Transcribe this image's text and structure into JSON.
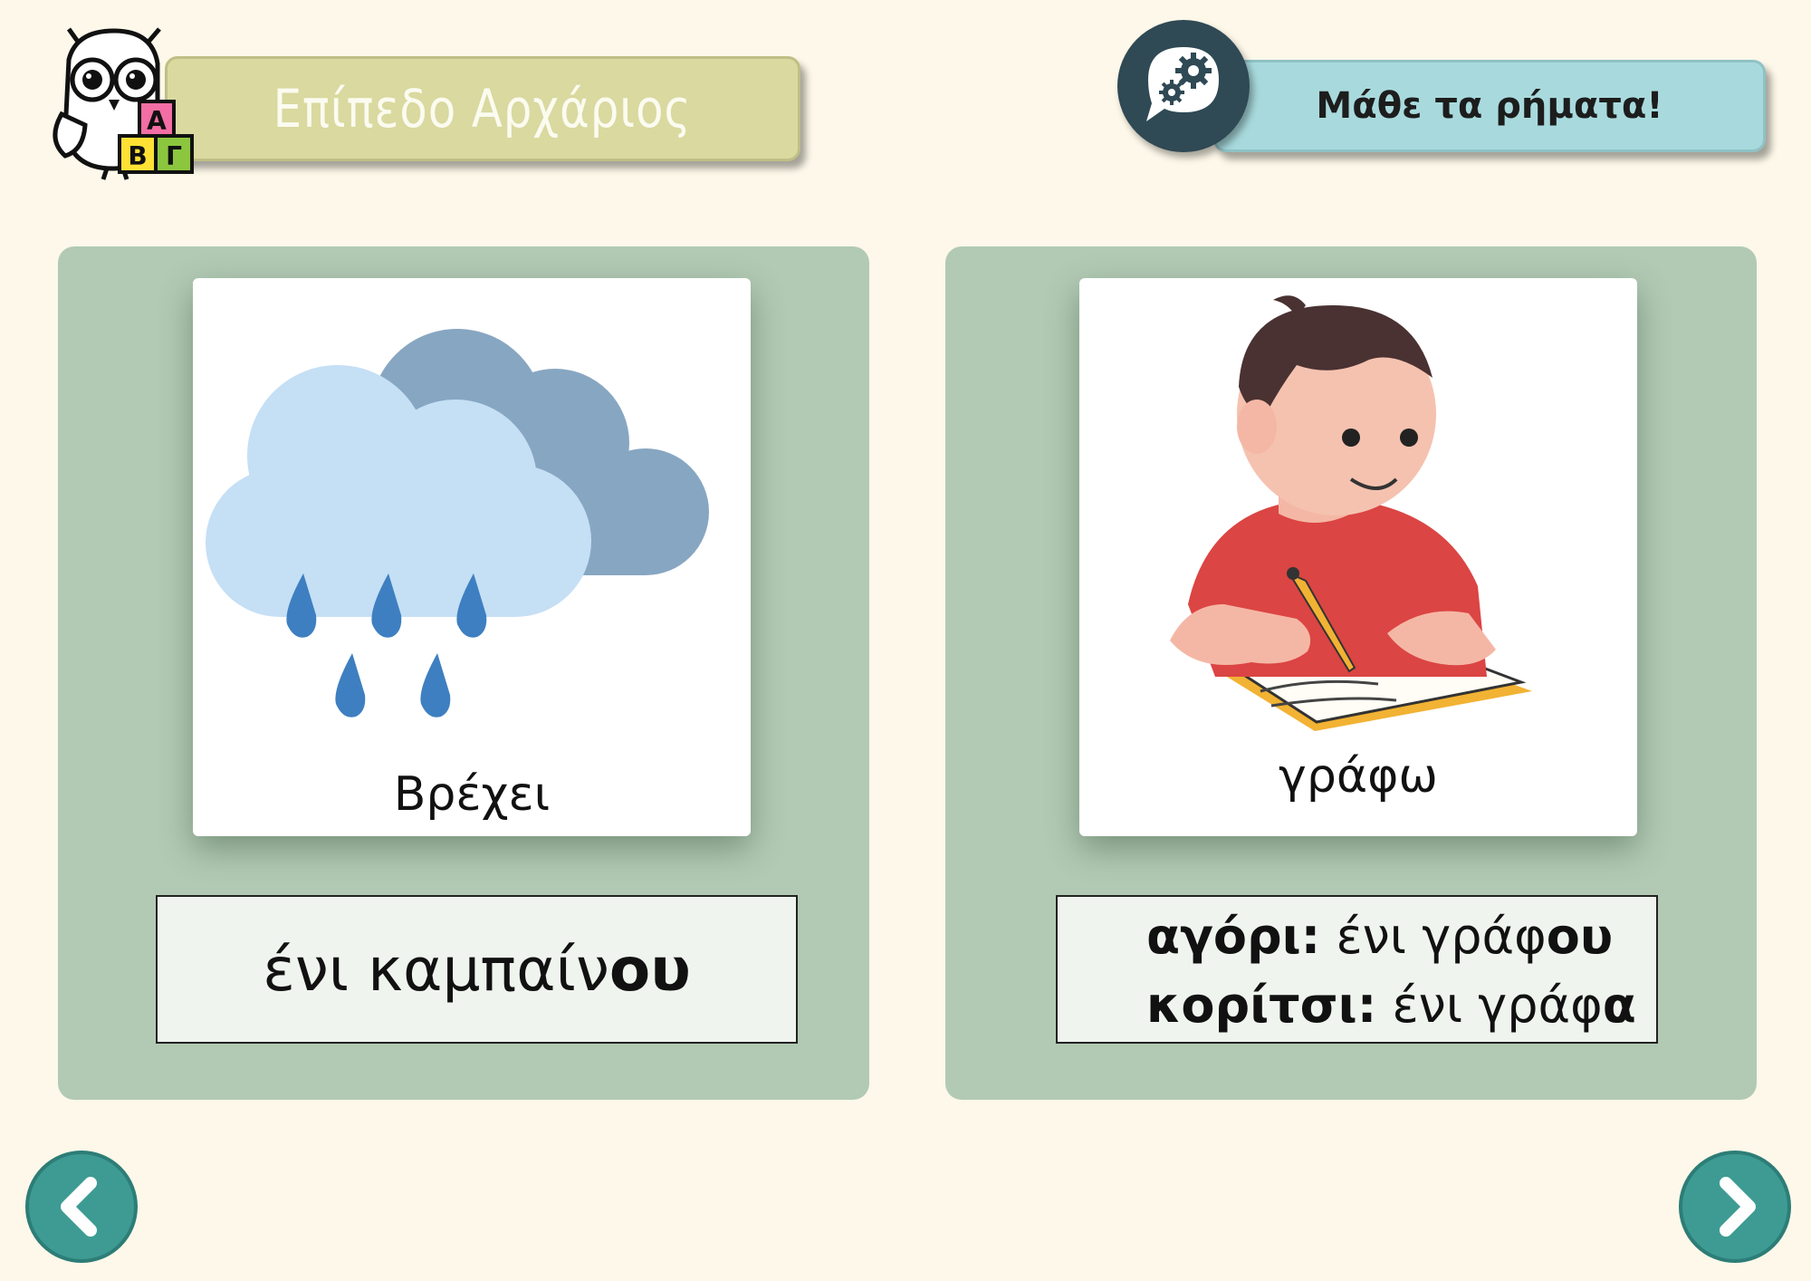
{
  "header": {
    "level_title": "Επίπεδο Αρχάριος",
    "verbs_title": "Μάθε τα ρήματα!",
    "logo_letters": [
      "Α",
      "Β",
      "Γ"
    ]
  },
  "cards": [
    {
      "caption": "Βρέχει",
      "answer": {
        "stem": "ένι καμπαίν",
        "ending": "ου"
      }
    },
    {
      "caption": "γράφω",
      "answer_lines": [
        {
          "label": "αγόρι:",
          "stem": " ένι γράφ",
          "ending": "ου"
        },
        {
          "label": "κορίτσι:",
          "stem": " ένι γράφ",
          "ending": "α"
        }
      ]
    }
  ],
  "nav": {
    "prev_icon": "chevron-left-icon",
    "next_icon": "chevron-right-icon"
  },
  "colors": {
    "background": "#fdf8e9",
    "panel": "#b2cab4",
    "level_banner": "#d9d9a0",
    "verbs_banner": "#a8dadd",
    "nav_button": "#3d9b93"
  }
}
